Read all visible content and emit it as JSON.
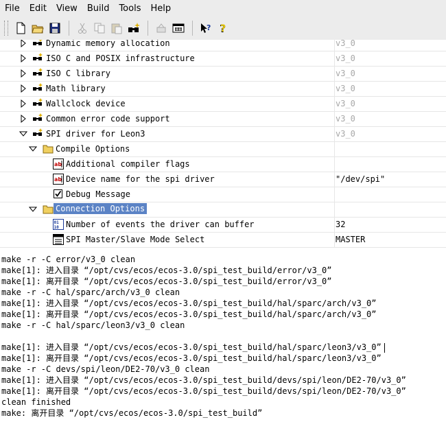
{
  "menu": [
    "File",
    "Edit",
    "View",
    "Build",
    "Tools",
    "Help"
  ],
  "toolbar": [
    "new-icon",
    "open-icon",
    "save-icon",
    "cut-icon",
    "copy-icon",
    "paste-icon",
    "find-icon",
    "delete-icon",
    "properties-icon",
    "whats-this-icon",
    "help-icon"
  ],
  "tree": {
    "rows": [
      {
        "label": "Dynamic memory allocation",
        "value": "v3_0"
      },
      {
        "label": "ISO C and POSIX infrastructure",
        "value": "v3_0"
      },
      {
        "label": "ISO C library",
        "value": "v3_0"
      },
      {
        "label": "Math library",
        "value": "v3_0"
      },
      {
        "label": "Wallclock device",
        "value": "v3_0"
      },
      {
        "label": "Common error code support",
        "value": "v3_0"
      },
      {
        "label": "SPI driver for Leon3",
        "value": "v3_0"
      },
      {
        "label": "Compile Options",
        "value": ""
      },
      {
        "label": "Additional compiler flags",
        "value": ""
      },
      {
        "label": "Device name for the spi driver",
        "value": "\"/dev/spi\""
      },
      {
        "label": "Debug Message",
        "value": ""
      },
      {
        "label": "Connection Options",
        "value": ""
      },
      {
        "label": "Number of events the driver can buffer",
        "value": "32"
      },
      {
        "label": "SPI Master/Slave Mode Select",
        "value": "MASTER"
      }
    ]
  },
  "console": {
    "lines": [
      "make -r -C error/v3_0 clean",
      "make[1]: 进入目录 “/opt/cvs/ecos/ecos-3.0/spi_test_build/error/v3_0”",
      "make[1]: 离开目录 “/opt/cvs/ecos/ecos-3.0/spi_test_build/error/v3_0”",
      "make -r -C hal/sparc/arch/v3_0 clean",
      "make[1]: 进入目录 “/opt/cvs/ecos/ecos-3.0/spi_test_build/hal/sparc/arch/v3_0”",
      "make[1]: 离开目录 “/opt/cvs/ecos/ecos-3.0/spi_test_build/hal/sparc/arch/v3_0”",
      "make -r -C hal/sparc/leon3/v3_0 clean",
      "",
      "make[1]: 进入目录 “/opt/cvs/ecos/ecos-3.0/spi_test_build/hal/sparc/leon3/v3_0”",
      "make[1]: 离开目录 “/opt/cvs/ecos/ecos-3.0/spi_test_build/hal/sparc/leon3/v3_0”",
      "make -r -C devs/spi/leon/DE2-70/v3_0 clean",
      "make[1]: 进入目录 “/opt/cvs/ecos/ecos-3.0/spi_test_build/devs/spi/leon/DE2-70/v3_0”",
      "make[1]: 离开目录 “/opt/cvs/ecos/ecos-3.0/spi_test_build/devs/spi/leon/DE2-70/v3_0”",
      "clean finished",
      "make: 离开目录 “/opt/cvs/ecos/ecos-3.0/spi_test_build”"
    ]
  }
}
